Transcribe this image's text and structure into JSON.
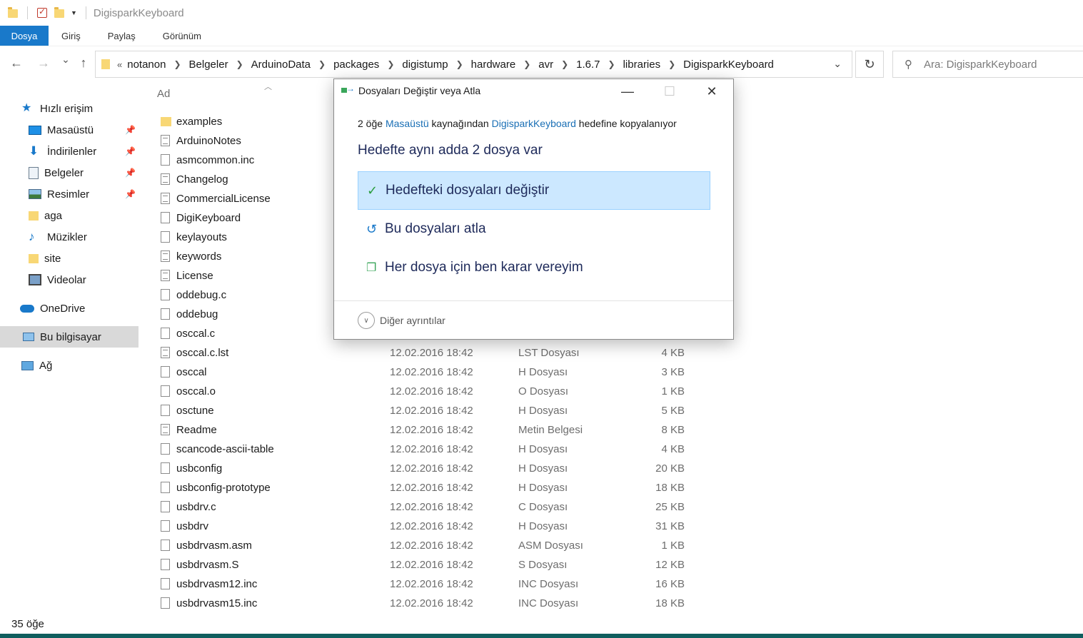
{
  "window": {
    "title": "DigisparkKeyboard"
  },
  "ribbon": {
    "tabs": [
      "Dosya",
      "Giriş",
      "Paylaş",
      "Görünüm"
    ]
  },
  "nav": {
    "back_icon": "←",
    "forward_icon": "→",
    "recent_icon": "⌄",
    "up_icon": "↑",
    "overflow": "«",
    "breadcrumbs": [
      "notanon",
      "Belgeler",
      "ArduinoData",
      "packages",
      "digistump",
      "hardware",
      "avr",
      "1.6.7",
      "libraries",
      "DigisparkKeyboard"
    ],
    "search_placeholder": "Ara: DigisparkKeyboard"
  },
  "sidebar": {
    "items": [
      {
        "label": "Hızlı erişim",
        "icon": "star-icon",
        "pinned": false,
        "selected": false
      },
      {
        "label": "Masaüstü",
        "icon": "desktop-icon",
        "pinned": true,
        "selected": false
      },
      {
        "label": "İndirilenler",
        "icon": "download-icon",
        "pinned": true,
        "selected": false
      },
      {
        "label": "Belgeler",
        "icon": "documents-icon",
        "pinned": true,
        "selected": false
      },
      {
        "label": "Resimler",
        "icon": "pictures-icon",
        "pinned": true,
        "selected": false
      },
      {
        "label": "aga",
        "icon": "folder-icon",
        "pinned": false,
        "selected": false
      },
      {
        "label": "Müzikler",
        "icon": "music-icon",
        "pinned": false,
        "selected": false
      },
      {
        "label": "site",
        "icon": "folder-icon",
        "pinned": false,
        "selected": false
      },
      {
        "label": "Videolar",
        "icon": "video-icon",
        "pinned": false,
        "selected": false
      },
      {
        "label": "OneDrive",
        "icon": "cloud-icon",
        "pinned": false,
        "selected": false
      },
      {
        "label": "Bu bilgisayar",
        "icon": "computer-icon",
        "pinned": false,
        "selected": true
      },
      {
        "label": "Ağ",
        "icon": "network-icon",
        "pinned": false,
        "selected": false
      }
    ]
  },
  "filelist": {
    "header_name": "Ad",
    "sort_glyph": "^",
    "files": [
      {
        "name": "examples",
        "kind": "folder",
        "date": "",
        "type": "",
        "size": ""
      },
      {
        "name": "ArduinoNotes",
        "kind": "text",
        "date": "",
        "type": "",
        "size": ""
      },
      {
        "name": "asmcommon.inc",
        "kind": "file",
        "date": "",
        "type": "",
        "size": ""
      },
      {
        "name": "Changelog",
        "kind": "text",
        "date": "",
        "type": "",
        "size": ""
      },
      {
        "name": "CommercialLicense",
        "kind": "text",
        "date": "",
        "type": "",
        "size": ""
      },
      {
        "name": "DigiKeyboard",
        "kind": "file",
        "date": "",
        "type": "",
        "size": ""
      },
      {
        "name": "keylayouts",
        "kind": "file",
        "date": "",
        "type": "",
        "size": ""
      },
      {
        "name": "keywords",
        "kind": "text",
        "date": "",
        "type": "",
        "size": ""
      },
      {
        "name": "License",
        "kind": "text",
        "date": "",
        "type": "",
        "size": ""
      },
      {
        "name": "oddebug.c",
        "kind": "file",
        "date": "",
        "type": "",
        "size": ""
      },
      {
        "name": "oddebug",
        "kind": "file",
        "date": "",
        "type": "",
        "size": ""
      },
      {
        "name": "osccal.c",
        "kind": "file",
        "date": "",
        "type": "",
        "size": ""
      },
      {
        "name": "osccal.c.lst",
        "kind": "text",
        "date": "12.02.2016 18:42",
        "type": "LST Dosyası",
        "size": "4 KB"
      },
      {
        "name": "osccal",
        "kind": "file",
        "date": "12.02.2016 18:42",
        "type": "H Dosyası",
        "size": "3 KB"
      },
      {
        "name": "osccal.o",
        "kind": "file",
        "date": "12.02.2016 18:42",
        "type": "O Dosyası",
        "size": "1 KB"
      },
      {
        "name": "osctune",
        "kind": "file",
        "date": "12.02.2016 18:42",
        "type": "H Dosyası",
        "size": "5 KB"
      },
      {
        "name": "Readme",
        "kind": "text",
        "date": "12.02.2016 18:42",
        "type": "Metin Belgesi",
        "size": "8 KB"
      },
      {
        "name": "scancode-ascii-table",
        "kind": "file",
        "date": "12.02.2016 18:42",
        "type": "H Dosyası",
        "size": "4 KB"
      },
      {
        "name": "usbconfig",
        "kind": "file",
        "date": "12.02.2016 18:42",
        "type": "H Dosyası",
        "size": "20 KB"
      },
      {
        "name": "usbconfig-prototype",
        "kind": "file",
        "date": "12.02.2016 18:42",
        "type": "H Dosyası",
        "size": "18 KB"
      },
      {
        "name": "usbdrv.c",
        "kind": "file",
        "date": "12.02.2016 18:42",
        "type": "C Dosyası",
        "size": "25 KB"
      },
      {
        "name": "usbdrv",
        "kind": "file",
        "date": "12.02.2016 18:42",
        "type": "H Dosyası",
        "size": "31 KB"
      },
      {
        "name": "usbdrvasm.asm",
        "kind": "file",
        "date": "12.02.2016 18:42",
        "type": "ASM Dosyası",
        "size": "1 KB"
      },
      {
        "name": "usbdrvasm.S",
        "kind": "file",
        "date": "12.02.2016 18:42",
        "type": "S Dosyası",
        "size": "12 KB"
      },
      {
        "name": "usbdrvasm12.inc",
        "kind": "file",
        "date": "12.02.2016 18:42",
        "type": "INC Dosyası",
        "size": "16 KB"
      },
      {
        "name": "usbdrvasm15.inc",
        "kind": "file",
        "date": "12.02.2016 18:42",
        "type": "INC Dosyası",
        "size": "18 KB"
      }
    ]
  },
  "status": {
    "count": "35 öğe"
  },
  "dialog": {
    "title": "Dosyaları Değiştir veya Atla",
    "minimize_glyph": "—",
    "maximize_glyph": "☐",
    "close_glyph": "✕",
    "msg_prefix": "2 öğe ",
    "source": "Masaüstü",
    "msg_middle": " kaynağından ",
    "destination": "DigisparkKeyboard",
    "msg_suffix": " hedefine kopyalanıyor",
    "heading": "Hedefte aynı adda 2 dosya var",
    "options": [
      {
        "label": "Hedefteki dosyaları değiştir",
        "icon": "check-icon",
        "glyph": "✓",
        "selected": true
      },
      {
        "label": "Bu dosyaları atla",
        "icon": "skip-icon",
        "glyph": "↺",
        "selected": false
      },
      {
        "label": "Her dosya için ben karar vereyim",
        "icon": "decide-icon",
        "glyph": "❐",
        "selected": false
      }
    ],
    "more_glyph": "∨",
    "more_details": "Diğer ayrıntılar"
  }
}
